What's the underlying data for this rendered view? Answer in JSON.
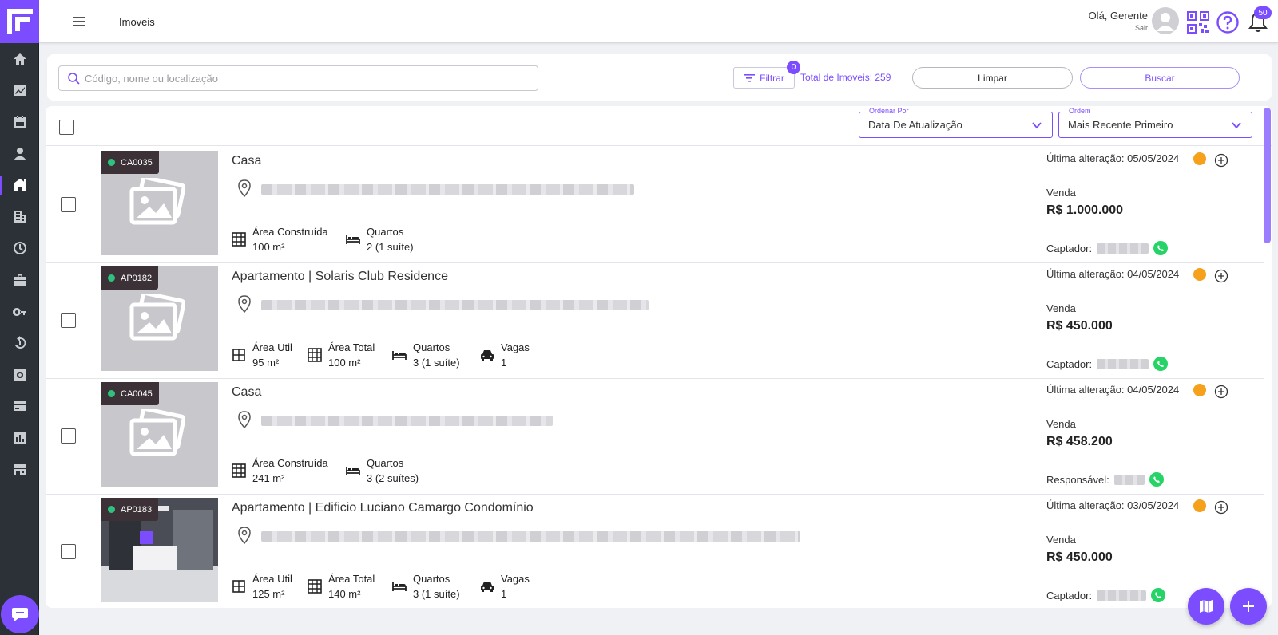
{
  "header": {
    "page_title": "Imoveis",
    "greeting": "Olá, Gerente",
    "logout": "Sair",
    "notification_count": "50"
  },
  "search": {
    "placeholder": "Código, nome ou localização",
    "filter_label": "Filtrar",
    "filter_count": "0",
    "total_label": "Total de Imoveis: 259",
    "clear_label": "Limpar",
    "search_label": "Buscar"
  },
  "sorting": {
    "order_by_legend": "Ordenar Por",
    "order_by_value": "Data De Atualização",
    "order_legend": "Ordem",
    "order_value": "Mais Recente Primeiro"
  },
  "sidebar": {
    "icons": [
      "home-icon",
      "chart-icon",
      "calendar-icon",
      "person-icon",
      "house-icon",
      "building-icon",
      "clock-icon",
      "briefcase-icon",
      "key-icon",
      "history-icon",
      "gear-icon",
      "card-icon",
      "report-icon",
      "store-icon"
    ],
    "active_index": 4
  },
  "properties": [
    {
      "code": "CA0035",
      "title": "Casa",
      "features": [
        {
          "label": "Área Construída",
          "value": "100 m²",
          "icon": "grid"
        },
        {
          "label": "Quartos",
          "value": "2 (1 suíte)",
          "icon": "bed"
        }
      ],
      "updated": "Última alteração: 05/05/2024",
      "deal": "Venda",
      "price": "R$ 1.000.000",
      "agent_label": "Captador:",
      "photo": false
    },
    {
      "code": "AP0182",
      "title": "Apartamento | Solaris Club Residence",
      "features": [
        {
          "label": "Área Util",
          "value": "95 m²",
          "icon": "grid-small"
        },
        {
          "label": "Área Total",
          "value": "100 m²",
          "icon": "grid"
        },
        {
          "label": "Quartos",
          "value": "3 (1 suíte)",
          "icon": "bed"
        },
        {
          "label": "Vagas",
          "value": "1",
          "icon": "car"
        }
      ],
      "updated": "Última alteração: 04/05/2024",
      "deal": "Venda",
      "price": "R$ 450.000",
      "agent_label": "Captador:",
      "photo": false
    },
    {
      "code": "CA0045",
      "title": "Casa",
      "features": [
        {
          "label": "Área Construída",
          "value": "241 m²",
          "icon": "grid"
        },
        {
          "label": "Quartos",
          "value": "3 (2 suítes)",
          "icon": "bed"
        }
      ],
      "updated": "Última alteração: 04/05/2024",
      "deal": "Venda",
      "price": "R$ 458.200",
      "agent_label": "Responsável:",
      "photo": false
    },
    {
      "code": "AP0183",
      "title": "Apartamento | Edificio Luciano Camargo Condomínio",
      "features": [
        {
          "label": "Área Util",
          "value": "125 m²",
          "icon": "grid-small"
        },
        {
          "label": "Área Total",
          "value": "140 m²",
          "icon": "grid"
        },
        {
          "label": "Quartos",
          "value": "3 (1 suíte)",
          "icon": "bed"
        },
        {
          "label": "Vagas",
          "value": "1",
          "icon": "car"
        }
      ],
      "updated": "Última alteração: 03/05/2024",
      "deal": "Venda",
      "price": "R$ 450.000",
      "agent_label": "Captador:",
      "photo": true
    }
  ],
  "colors": {
    "accent": "#7c4dff",
    "sidebar": "#2b3136",
    "status_ok": "#2ec27e",
    "clock": "#f5a11c",
    "whatsapp": "#25d366"
  }
}
